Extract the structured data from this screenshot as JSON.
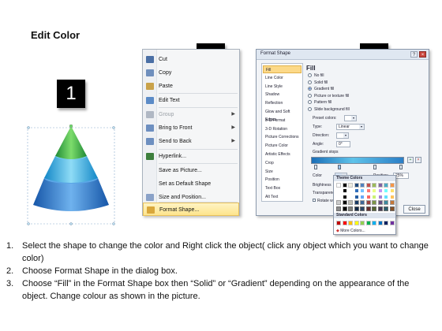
{
  "title": "Edit Color",
  "steps": [
    "1",
    "2",
    "3"
  ],
  "colors": {
    "green": "#33b34a",
    "cyan": "#3bb3e3",
    "blue": "#2a76cf",
    "highlight": "#fde48c"
  },
  "context_menu": {
    "items": [
      {
        "label": "Cut",
        "icon": "scissors-icon",
        "color": "#4a6fa5"
      },
      {
        "label": "Copy",
        "icon": "copy-icon",
        "color": "#6f8fbd"
      },
      {
        "label": "Paste",
        "icon": "paste-icon",
        "color": "#c9a24a"
      },
      {
        "label": "Edit Text",
        "icon": "edit-text-icon",
        "color": "#5b8bc7"
      },
      {
        "label": "Group",
        "icon": "group-icon",
        "color": "#b0b8c4",
        "disabled": true,
        "submenu": true
      },
      {
        "label": "Bring to Front",
        "icon": "bring-to-front-icon",
        "color": "#6d8fc0",
        "submenu": true
      },
      {
        "label": "Send to Back",
        "icon": "send-to-back-icon",
        "color": "#6d8fc0",
        "submenu": true
      },
      {
        "label": "Hyperlink...",
        "icon": "globe-icon",
        "color": "#3d7f3d"
      },
      {
        "label": "Save as Picture...",
        "icon": "",
        "color": ""
      },
      {
        "label": "Set as Default Shape",
        "icon": "",
        "color": ""
      },
      {
        "label": "Size and Position...",
        "icon": "size-icon",
        "color": "#8aa2c8"
      },
      {
        "label": "Format Shape...",
        "icon": "format-shape-icon",
        "color": "#d9a73b",
        "highlight": true
      }
    ]
  },
  "dialog": {
    "title": "Format Shape",
    "nav": [
      "Fill",
      "Line Color",
      "Line Style",
      "Shadow",
      "Reflection",
      "Glow and Soft Edges",
      "3-D Format",
      "3-D Rotation",
      "Picture Corrections",
      "Picture Color",
      "Artistic Effects",
      "Crop",
      "Size",
      "Position",
      "Text Box",
      "Alt Text"
    ],
    "fill_heading": "Fill",
    "fill_options": [
      "No fill",
      "Solid fill",
      "Gradient fill",
      "Picture or texture fill",
      "Pattern fill",
      "Slide background fill"
    ],
    "selected_fill": 2,
    "fields": {
      "preset": "Preset colors:",
      "type_label": "Type:",
      "type_value": "Linear",
      "direction_label": "Direction:",
      "angle_label": "Angle:",
      "angle_value": "0°",
      "stops_label": "Gradient stops",
      "color_label": "Color",
      "position_label": "Position:",
      "position_value": "25%",
      "brightness_label": "Brightness",
      "transparency_label": "Transparency",
      "rotate_label": "Rotate with shape"
    },
    "close_label": "Close",
    "palette": {
      "theme_heading": "Theme Colors",
      "standard_heading": "Standard Colors",
      "more_label": "More Colors...",
      "theme": [
        "#ffffff",
        "#000000",
        "#eeece1",
        "#1f497d",
        "#4f81bd",
        "#c0504d",
        "#9bbb59",
        "#8064a2",
        "#4bacc6",
        "#f79646"
      ],
      "standard": [
        "#c00000",
        "#ff0000",
        "#ffc000",
        "#ffff00",
        "#92d050",
        "#00b050",
        "#00b0f0",
        "#0070c0",
        "#002060",
        "#7030a0"
      ]
    }
  },
  "instructions": [
    {
      "num": "1.",
      "text": "Select the shape to change the color and Right click the object( click any object which you want to change color)"
    },
    {
      "num": "2.",
      "text": "Choose Format Shape in the dialog box."
    },
    {
      "num": "3.",
      "text": "Choose “Fill” in the Format Shape box then “Solid” or “Gradient” depending on the appearance of the object. Change colour as shown in the picture."
    }
  ]
}
